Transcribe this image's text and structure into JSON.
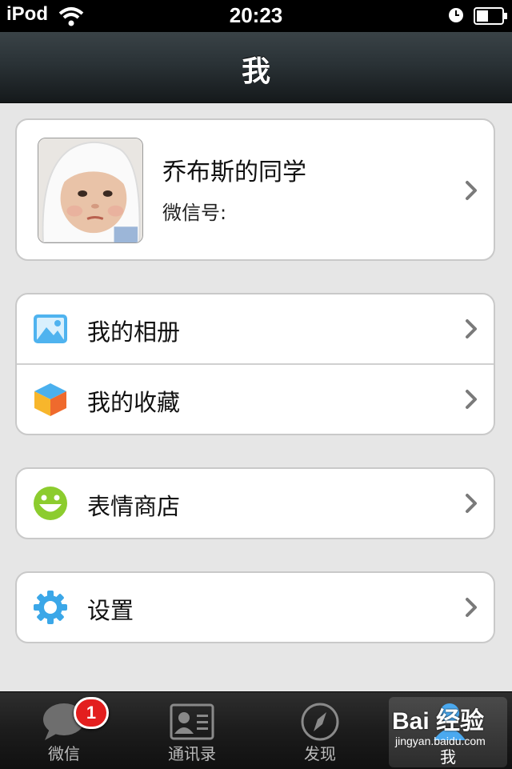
{
  "status_bar": {
    "carrier": "iPod",
    "time": "20:23"
  },
  "nav": {
    "title": "我"
  },
  "profile": {
    "name": "乔布斯的同学",
    "wechat_id_label": "微信号:"
  },
  "menu": {
    "album": "我的相册",
    "favorites": "我的收藏",
    "sticker_shop": "表情商店",
    "settings": "设置"
  },
  "tabs": [
    {
      "label": "微信",
      "badge": "1",
      "icon": "chat-bubble-icon"
    },
    {
      "label": "通讯录",
      "icon": "contacts-card-icon"
    },
    {
      "label": "发现",
      "icon": "compass-icon"
    },
    {
      "label": "我",
      "icon": "person-icon",
      "active": true
    }
  ],
  "watermark": {
    "brand": "Bai 经验",
    "url": "jingyan.baidu.com"
  },
  "colors": {
    "accent_blue": "#3ba7e8",
    "badge_red": "#e31e1e",
    "smiley_green": "#8ccc2e"
  }
}
